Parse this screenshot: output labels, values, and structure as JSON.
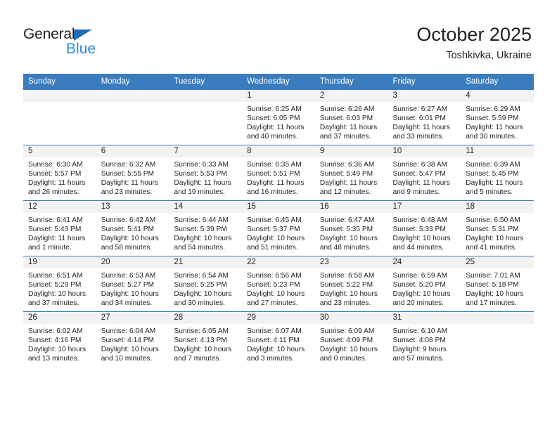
{
  "brand": {
    "name_part1": "General",
    "name_part2": "Blue",
    "triangle_color": "#1f6db5",
    "blue_color": "#2e8bd8"
  },
  "header": {
    "title": "October 2025",
    "location": "Toshkivka, Ukraine"
  },
  "theme": {
    "header_row_bg": "#3a7cbe",
    "daynum_band_bg": "#f2f2f2",
    "text_color": "#231f20",
    "grid_line": "#3a7cbe"
  },
  "calendar": {
    "weekday_headers": [
      "Sunday",
      "Monday",
      "Tuesday",
      "Wednesday",
      "Thursday",
      "Friday",
      "Saturday"
    ],
    "labels": {
      "sunrise_prefix": "Sunrise:",
      "sunset_prefix": "Sunset:",
      "daylight_prefix": "Daylight:"
    },
    "weeks": [
      [
        {
          "empty": true
        },
        {
          "empty": true
        },
        {
          "empty": true
        },
        {
          "day": "1",
          "sunrise": "Sunrise: 6:25 AM",
          "sunset": "Sunset: 6:05 PM",
          "daylight_line1": "Daylight: 11 hours",
          "daylight_line2": "and 40 minutes."
        },
        {
          "day": "2",
          "sunrise": "Sunrise: 6:26 AM",
          "sunset": "Sunset: 6:03 PM",
          "daylight_line1": "Daylight: 11 hours",
          "daylight_line2": "and 37 minutes."
        },
        {
          "day": "3",
          "sunrise": "Sunrise: 6:27 AM",
          "sunset": "Sunset: 6:01 PM",
          "daylight_line1": "Daylight: 11 hours",
          "daylight_line2": "and 33 minutes."
        },
        {
          "day": "4",
          "sunrise": "Sunrise: 6:29 AM",
          "sunset": "Sunset: 5:59 PM",
          "daylight_line1": "Daylight: 11 hours",
          "daylight_line2": "and 30 minutes."
        }
      ],
      [
        {
          "day": "5",
          "sunrise": "Sunrise: 6:30 AM",
          "sunset": "Sunset: 5:57 PM",
          "daylight_line1": "Daylight: 11 hours",
          "daylight_line2": "and 26 minutes."
        },
        {
          "day": "6",
          "sunrise": "Sunrise: 6:32 AM",
          "sunset": "Sunset: 5:55 PM",
          "daylight_line1": "Daylight: 11 hours",
          "daylight_line2": "and 23 minutes."
        },
        {
          "day": "7",
          "sunrise": "Sunrise: 6:33 AM",
          "sunset": "Sunset: 5:53 PM",
          "daylight_line1": "Daylight: 11 hours",
          "daylight_line2": "and 19 minutes."
        },
        {
          "day": "8",
          "sunrise": "Sunrise: 6:35 AM",
          "sunset": "Sunset: 5:51 PM",
          "daylight_line1": "Daylight: 11 hours",
          "daylight_line2": "and 16 minutes."
        },
        {
          "day": "9",
          "sunrise": "Sunrise: 6:36 AM",
          "sunset": "Sunset: 5:49 PM",
          "daylight_line1": "Daylight: 11 hours",
          "daylight_line2": "and 12 minutes."
        },
        {
          "day": "10",
          "sunrise": "Sunrise: 6:38 AM",
          "sunset": "Sunset: 5:47 PM",
          "daylight_line1": "Daylight: 11 hours",
          "daylight_line2": "and 9 minutes."
        },
        {
          "day": "11",
          "sunrise": "Sunrise: 6:39 AM",
          "sunset": "Sunset: 5:45 PM",
          "daylight_line1": "Daylight: 11 hours",
          "daylight_line2": "and 5 minutes."
        }
      ],
      [
        {
          "day": "12",
          "sunrise": "Sunrise: 6:41 AM",
          "sunset": "Sunset: 5:43 PM",
          "daylight_line1": "Daylight: 11 hours",
          "daylight_line2": "and 1 minute."
        },
        {
          "day": "13",
          "sunrise": "Sunrise: 6:42 AM",
          "sunset": "Sunset: 5:41 PM",
          "daylight_line1": "Daylight: 10 hours",
          "daylight_line2": "and 58 minutes."
        },
        {
          "day": "14",
          "sunrise": "Sunrise: 6:44 AM",
          "sunset": "Sunset: 5:39 PM",
          "daylight_line1": "Daylight: 10 hours",
          "daylight_line2": "and 54 minutes."
        },
        {
          "day": "15",
          "sunrise": "Sunrise: 6:45 AM",
          "sunset": "Sunset: 5:37 PM",
          "daylight_line1": "Daylight: 10 hours",
          "daylight_line2": "and 51 minutes."
        },
        {
          "day": "16",
          "sunrise": "Sunrise: 6:47 AM",
          "sunset": "Sunset: 5:35 PM",
          "daylight_line1": "Daylight: 10 hours",
          "daylight_line2": "and 48 minutes."
        },
        {
          "day": "17",
          "sunrise": "Sunrise: 6:48 AM",
          "sunset": "Sunset: 5:33 PM",
          "daylight_line1": "Daylight: 10 hours",
          "daylight_line2": "and 44 minutes."
        },
        {
          "day": "18",
          "sunrise": "Sunrise: 6:50 AM",
          "sunset": "Sunset: 5:31 PM",
          "daylight_line1": "Daylight: 10 hours",
          "daylight_line2": "and 41 minutes."
        }
      ],
      [
        {
          "day": "19",
          "sunrise": "Sunrise: 6:51 AM",
          "sunset": "Sunset: 5:29 PM",
          "daylight_line1": "Daylight: 10 hours",
          "daylight_line2": "and 37 minutes."
        },
        {
          "day": "20",
          "sunrise": "Sunrise: 6:53 AM",
          "sunset": "Sunset: 5:27 PM",
          "daylight_line1": "Daylight: 10 hours",
          "daylight_line2": "and 34 minutes."
        },
        {
          "day": "21",
          "sunrise": "Sunrise: 6:54 AM",
          "sunset": "Sunset: 5:25 PM",
          "daylight_line1": "Daylight: 10 hours",
          "daylight_line2": "and 30 minutes."
        },
        {
          "day": "22",
          "sunrise": "Sunrise: 6:56 AM",
          "sunset": "Sunset: 5:23 PM",
          "daylight_line1": "Daylight: 10 hours",
          "daylight_line2": "and 27 minutes."
        },
        {
          "day": "23",
          "sunrise": "Sunrise: 6:58 AM",
          "sunset": "Sunset: 5:22 PM",
          "daylight_line1": "Daylight: 10 hours",
          "daylight_line2": "and 23 minutes."
        },
        {
          "day": "24",
          "sunrise": "Sunrise: 6:59 AM",
          "sunset": "Sunset: 5:20 PM",
          "daylight_line1": "Daylight: 10 hours",
          "daylight_line2": "and 20 minutes."
        },
        {
          "day": "25",
          "sunrise": "Sunrise: 7:01 AM",
          "sunset": "Sunset: 5:18 PM",
          "daylight_line1": "Daylight: 10 hours",
          "daylight_line2": "and 17 minutes."
        }
      ],
      [
        {
          "day": "26",
          "sunrise": "Sunrise: 6:02 AM",
          "sunset": "Sunset: 4:16 PM",
          "daylight_line1": "Daylight: 10 hours",
          "daylight_line2": "and 13 minutes."
        },
        {
          "day": "27",
          "sunrise": "Sunrise: 6:04 AM",
          "sunset": "Sunset: 4:14 PM",
          "daylight_line1": "Daylight: 10 hours",
          "daylight_line2": "and 10 minutes."
        },
        {
          "day": "28",
          "sunrise": "Sunrise: 6:05 AM",
          "sunset": "Sunset: 4:13 PM",
          "daylight_line1": "Daylight: 10 hours",
          "daylight_line2": "and 7 minutes."
        },
        {
          "day": "29",
          "sunrise": "Sunrise: 6:07 AM",
          "sunset": "Sunset: 4:11 PM",
          "daylight_line1": "Daylight: 10 hours",
          "daylight_line2": "and 3 minutes."
        },
        {
          "day": "30",
          "sunrise": "Sunrise: 6:09 AM",
          "sunset": "Sunset: 4:09 PM",
          "daylight_line1": "Daylight: 10 hours",
          "daylight_line2": "and 0 minutes."
        },
        {
          "day": "31",
          "sunrise": "Sunrise: 6:10 AM",
          "sunset": "Sunset: 4:08 PM",
          "daylight_line1": "Daylight: 9 hours",
          "daylight_line2": "and 57 minutes."
        },
        {
          "empty": true
        }
      ]
    ]
  }
}
